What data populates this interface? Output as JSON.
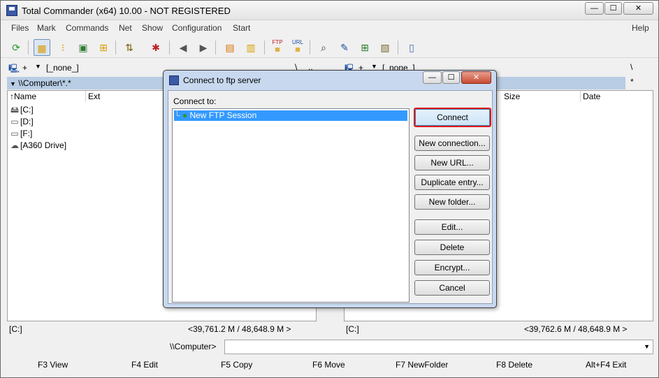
{
  "window": {
    "title": "Total Commander (x64) 10.00 - NOT REGISTERED",
    "minimize": "—",
    "maximize": "☐",
    "close": "✕"
  },
  "menu": [
    "Files",
    "Mark",
    "Commands",
    "Net",
    "Show",
    "Configuration",
    "Start",
    "Help"
  ],
  "toolbar": {
    "icons": [
      "refresh-icon",
      "brief-view-icon",
      "detailed-view-icon",
      "thumbnail-view-icon",
      "tree-view-icon",
      "sort-icon",
      "invert-selection-icon",
      "back-icon",
      "forward-icon",
      "pack-icon",
      "unpack-icon",
      "ftp-connect-icon",
      "url-connect-icon",
      "find-icon",
      "rename-icon",
      "sync-dirs-icon",
      "compare-icon",
      "notepad-icon"
    ],
    "ftp_label": "FTP",
    "url_label": "URL"
  },
  "left_panel": {
    "drive": "+",
    "drive_label": "[_none_]",
    "path": "\\\\Computer\\*.*",
    "columns": [
      "Name",
      "Ext"
    ],
    "rows": [
      {
        "icon": "drive-c-icon",
        "name": "[C:]"
      },
      {
        "icon": "drive-d-icon",
        "name": "[D:]"
      },
      {
        "icon": "drive-f-icon",
        "name": "[F:]"
      },
      {
        "icon": "cloud-drive-icon",
        "name": "[A360 Drive]"
      }
    ],
    "status_drive": "[C:]",
    "status_space": "<39,761.2 M / 48,648.9 M >"
  },
  "right_panel": {
    "drive": "+",
    "drive_label": "[_none_]",
    "backslash_left": "\\",
    "dotdot": "..",
    "backslash_right": "\\",
    "star": "*",
    "columns": [
      "Size",
      "Date"
    ],
    "status_drive": "[C:]",
    "status_space": "<39,762.6 M / 48,648.9 M >"
  },
  "command_line": {
    "prompt": "\\\\Computer>",
    "value": ""
  },
  "function_keys": [
    "F3 View",
    "F4 Edit",
    "F5 Copy",
    "F6 Move",
    "F7 NewFolder",
    "F8 Delete",
    "Alt+F4 Exit"
  ],
  "dialog": {
    "title": "Connect to ftp server",
    "connect_to_label": "Connect to:",
    "tree_items": [
      "New FTP Session"
    ],
    "buttons": {
      "connect": "Connect",
      "new_connection": "New connection...",
      "new_url": "New URL...",
      "duplicate": "Duplicate entry...",
      "new_folder": "New folder...",
      "edit": "Edit...",
      "delete": "Delete",
      "encrypt": "Encrypt...",
      "cancel": "Cancel"
    }
  },
  "colors": {
    "highlight": "#3399ff",
    "path_bar": "#b8cde4",
    "connect_outline": "#e01919"
  }
}
